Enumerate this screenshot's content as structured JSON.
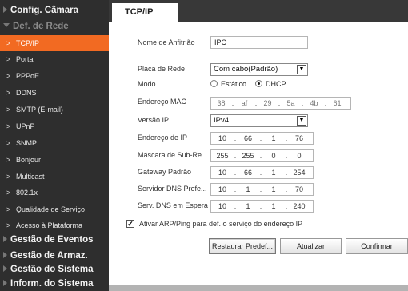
{
  "sidebar": {
    "sections": {
      "camera": "Config. Câmara",
      "network": "Def. de Rede",
      "events": "Gestão de Eventos",
      "storage": "Gestão de Armaz.",
      "system": "Gestão do Sistema",
      "info": "Inform. do Sistema"
    },
    "items": [
      {
        "label": "TCP/IP",
        "active": true
      },
      {
        "label": "Porta"
      },
      {
        "label": "PPPoE"
      },
      {
        "label": "DDNS"
      },
      {
        "label": "SMTP (E-mail)"
      },
      {
        "label": "UPnP"
      },
      {
        "label": "SNMP"
      },
      {
        "label": "Bonjour"
      },
      {
        "label": "Multicast"
      },
      {
        "label": "802.1x"
      },
      {
        "label": "Qualidade de Serviço"
      },
      {
        "label": "Acesso à Plataforma"
      }
    ],
    "accent": "#f26a22"
  },
  "tab": {
    "label": "TCP/IP"
  },
  "form": {
    "hostname": {
      "label": "Nome de Anfitrião",
      "value": "IPC"
    },
    "nic": {
      "label": "Placa de Rede",
      "value": "Com cabo(Padrão)"
    },
    "mode": {
      "label": "Modo",
      "static": "Estático",
      "dhcp": "DHCP",
      "selected": "DHCP"
    },
    "mac": {
      "label": "Endereço MAC",
      "octets": [
        "38",
        "af",
        "29",
        "5a",
        "4b",
        "61"
      ]
    },
    "ipversion": {
      "label": "Versão IP",
      "value": "IPv4"
    },
    "ip": {
      "label": "Endereço de IP",
      "octets": [
        "10",
        "66",
        "1",
        "76"
      ]
    },
    "mask": {
      "label": "Máscara de Sub-Re...",
      "octets": [
        "255",
        "255",
        "0",
        "0"
      ]
    },
    "gateway": {
      "label": "Gateway Padrão",
      "octets": [
        "10",
        "66",
        "1",
        "254"
      ]
    },
    "dns1": {
      "label": "Servidor DNS Prefe...",
      "octets": [
        "10",
        "1",
        "1",
        "70"
      ]
    },
    "dns2": {
      "label": "Serv. DNS em Espera",
      "octets": [
        "10",
        "1",
        "1",
        "240"
      ]
    },
    "arp": {
      "label": "Ativar ARP/Ping para def. o serviço do endereço IP",
      "checked": true
    }
  },
  "buttons": {
    "restore": "Restaurar Predef...",
    "refresh": "Atualizar",
    "confirm": "Confirmar"
  }
}
